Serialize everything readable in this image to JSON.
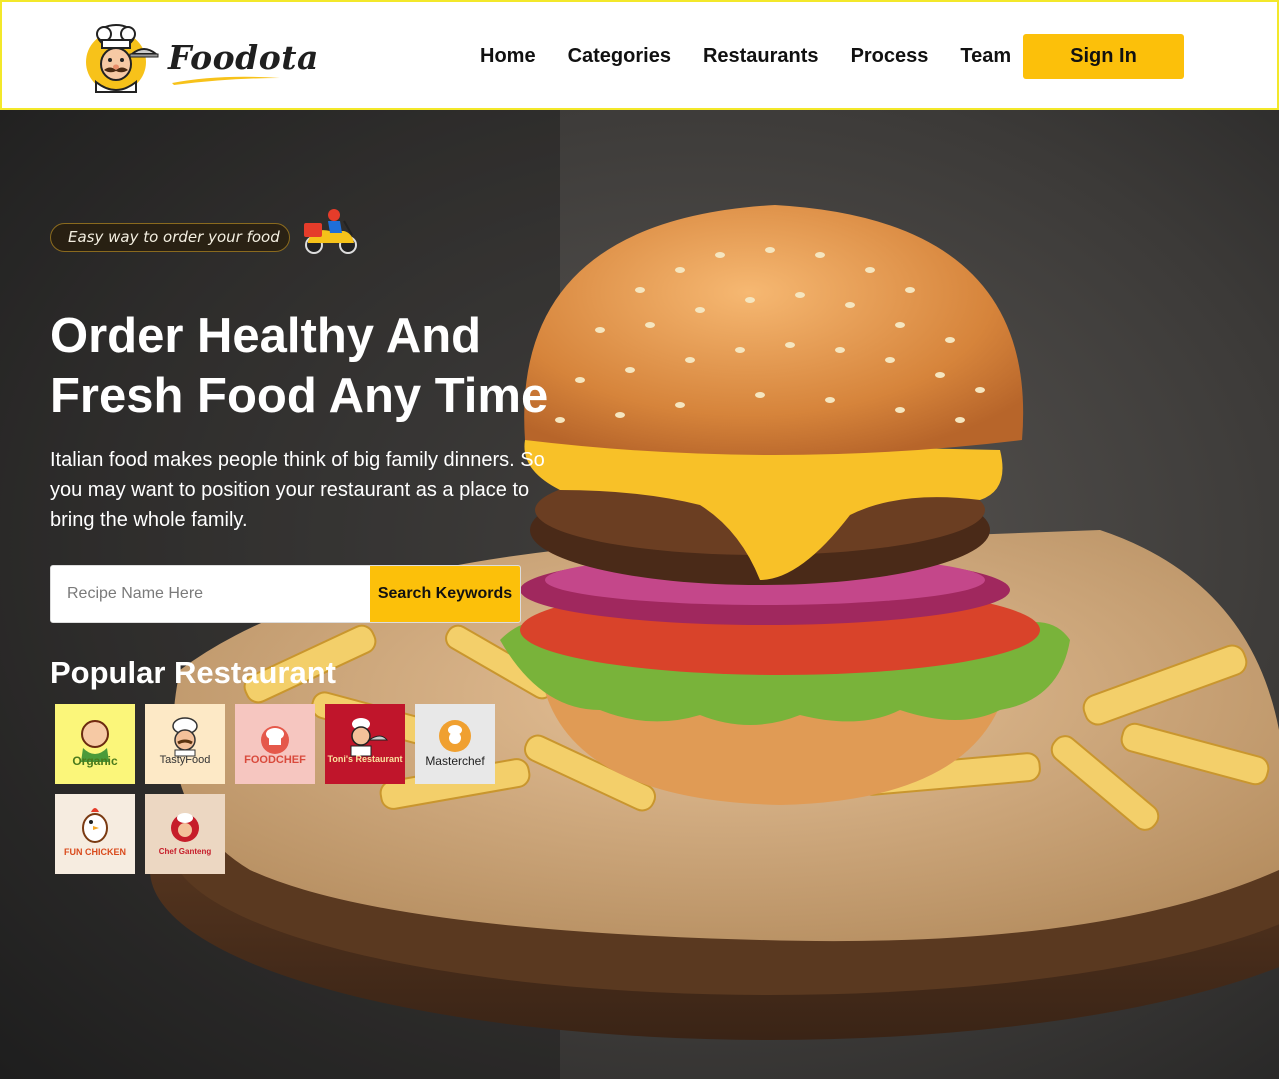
{
  "header": {
    "brand": "Foodota",
    "logo_icon": "chef-mascot-icon",
    "nav": [
      {
        "label": "Home"
      },
      {
        "label": "Categories"
      },
      {
        "label": "Restaurants"
      },
      {
        "label": "Process"
      },
      {
        "label": "Team"
      }
    ],
    "sign_in_label": "Sign In"
  },
  "hero": {
    "tagline": "Easy way to order your food",
    "tagline_icon": "delivery-scooter-icon",
    "title_line1": "Order Healthy And",
    "title_line2": "Fresh Food Any Time",
    "description": "Italian food makes people think of big family dinners. So you may want to position your restaurant as a place to bring the whole family.",
    "background_image": "burger-with-fries-photo",
    "search": {
      "placeholder": "Recipe Name Here",
      "button_label": "Search Keywords"
    },
    "popular_title": "Popular Restaurant",
    "restaurants": [
      {
        "name": "Organic",
        "bg": "#fbf67a"
      },
      {
        "name": "TastyFood",
        "bg": "#fde9c6"
      },
      {
        "name": "FOODCHEF",
        "bg": "#f6c6c0"
      },
      {
        "name": "Toni's Restaurant",
        "bg": "#c0152b"
      },
      {
        "name": "Masterchef",
        "bg": "#e8e8e8"
      },
      {
        "name": "FUN CHICKEN",
        "bg": "#f6ece0"
      },
      {
        "name": "Chef Ganteng",
        "bg": "#ecd7c2"
      }
    ]
  },
  "colors": {
    "accent": "#fcc00a",
    "header_border": "#f3e82a",
    "text_dark": "#111111",
    "text_light": "#ffffff"
  }
}
